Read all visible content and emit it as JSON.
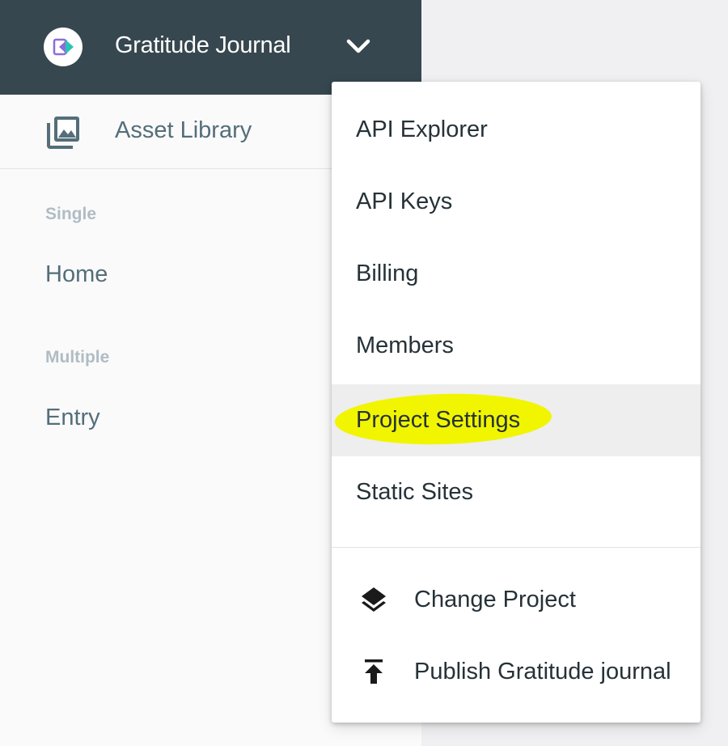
{
  "header": {
    "project_name": "Gratitude Journal"
  },
  "sidebar": {
    "asset_library_label": "Asset Library",
    "sections": [
      {
        "label": "Single",
        "items": [
          "Home"
        ]
      },
      {
        "label": "Multiple",
        "items": [
          "Entry"
        ]
      }
    ]
  },
  "project_menu": {
    "items": [
      {
        "label": "API Explorer"
      },
      {
        "label": "API Keys"
      },
      {
        "label": "Billing"
      },
      {
        "label": "Members"
      },
      {
        "label": "Project Settings",
        "hovered": true,
        "annotated_highlight": true
      },
      {
        "label": "Static Sites"
      }
    ],
    "actions": [
      {
        "label": "Change Project",
        "icon": "layers-icon"
      },
      {
        "label": "Publish Gratitude journal",
        "icon": "publish-icon"
      }
    ]
  },
  "colors": {
    "header_bg": "#37474f",
    "sidebar_bg": "#fafafa",
    "nav_text": "#546e7a",
    "section_label": "#b0bcc4",
    "menu_text": "#263238",
    "hover_bg": "#eeeeee",
    "highlighter": "#f1f500",
    "logo_purple": "#8e6bd8",
    "logo_teal": "#2bc4b4"
  }
}
